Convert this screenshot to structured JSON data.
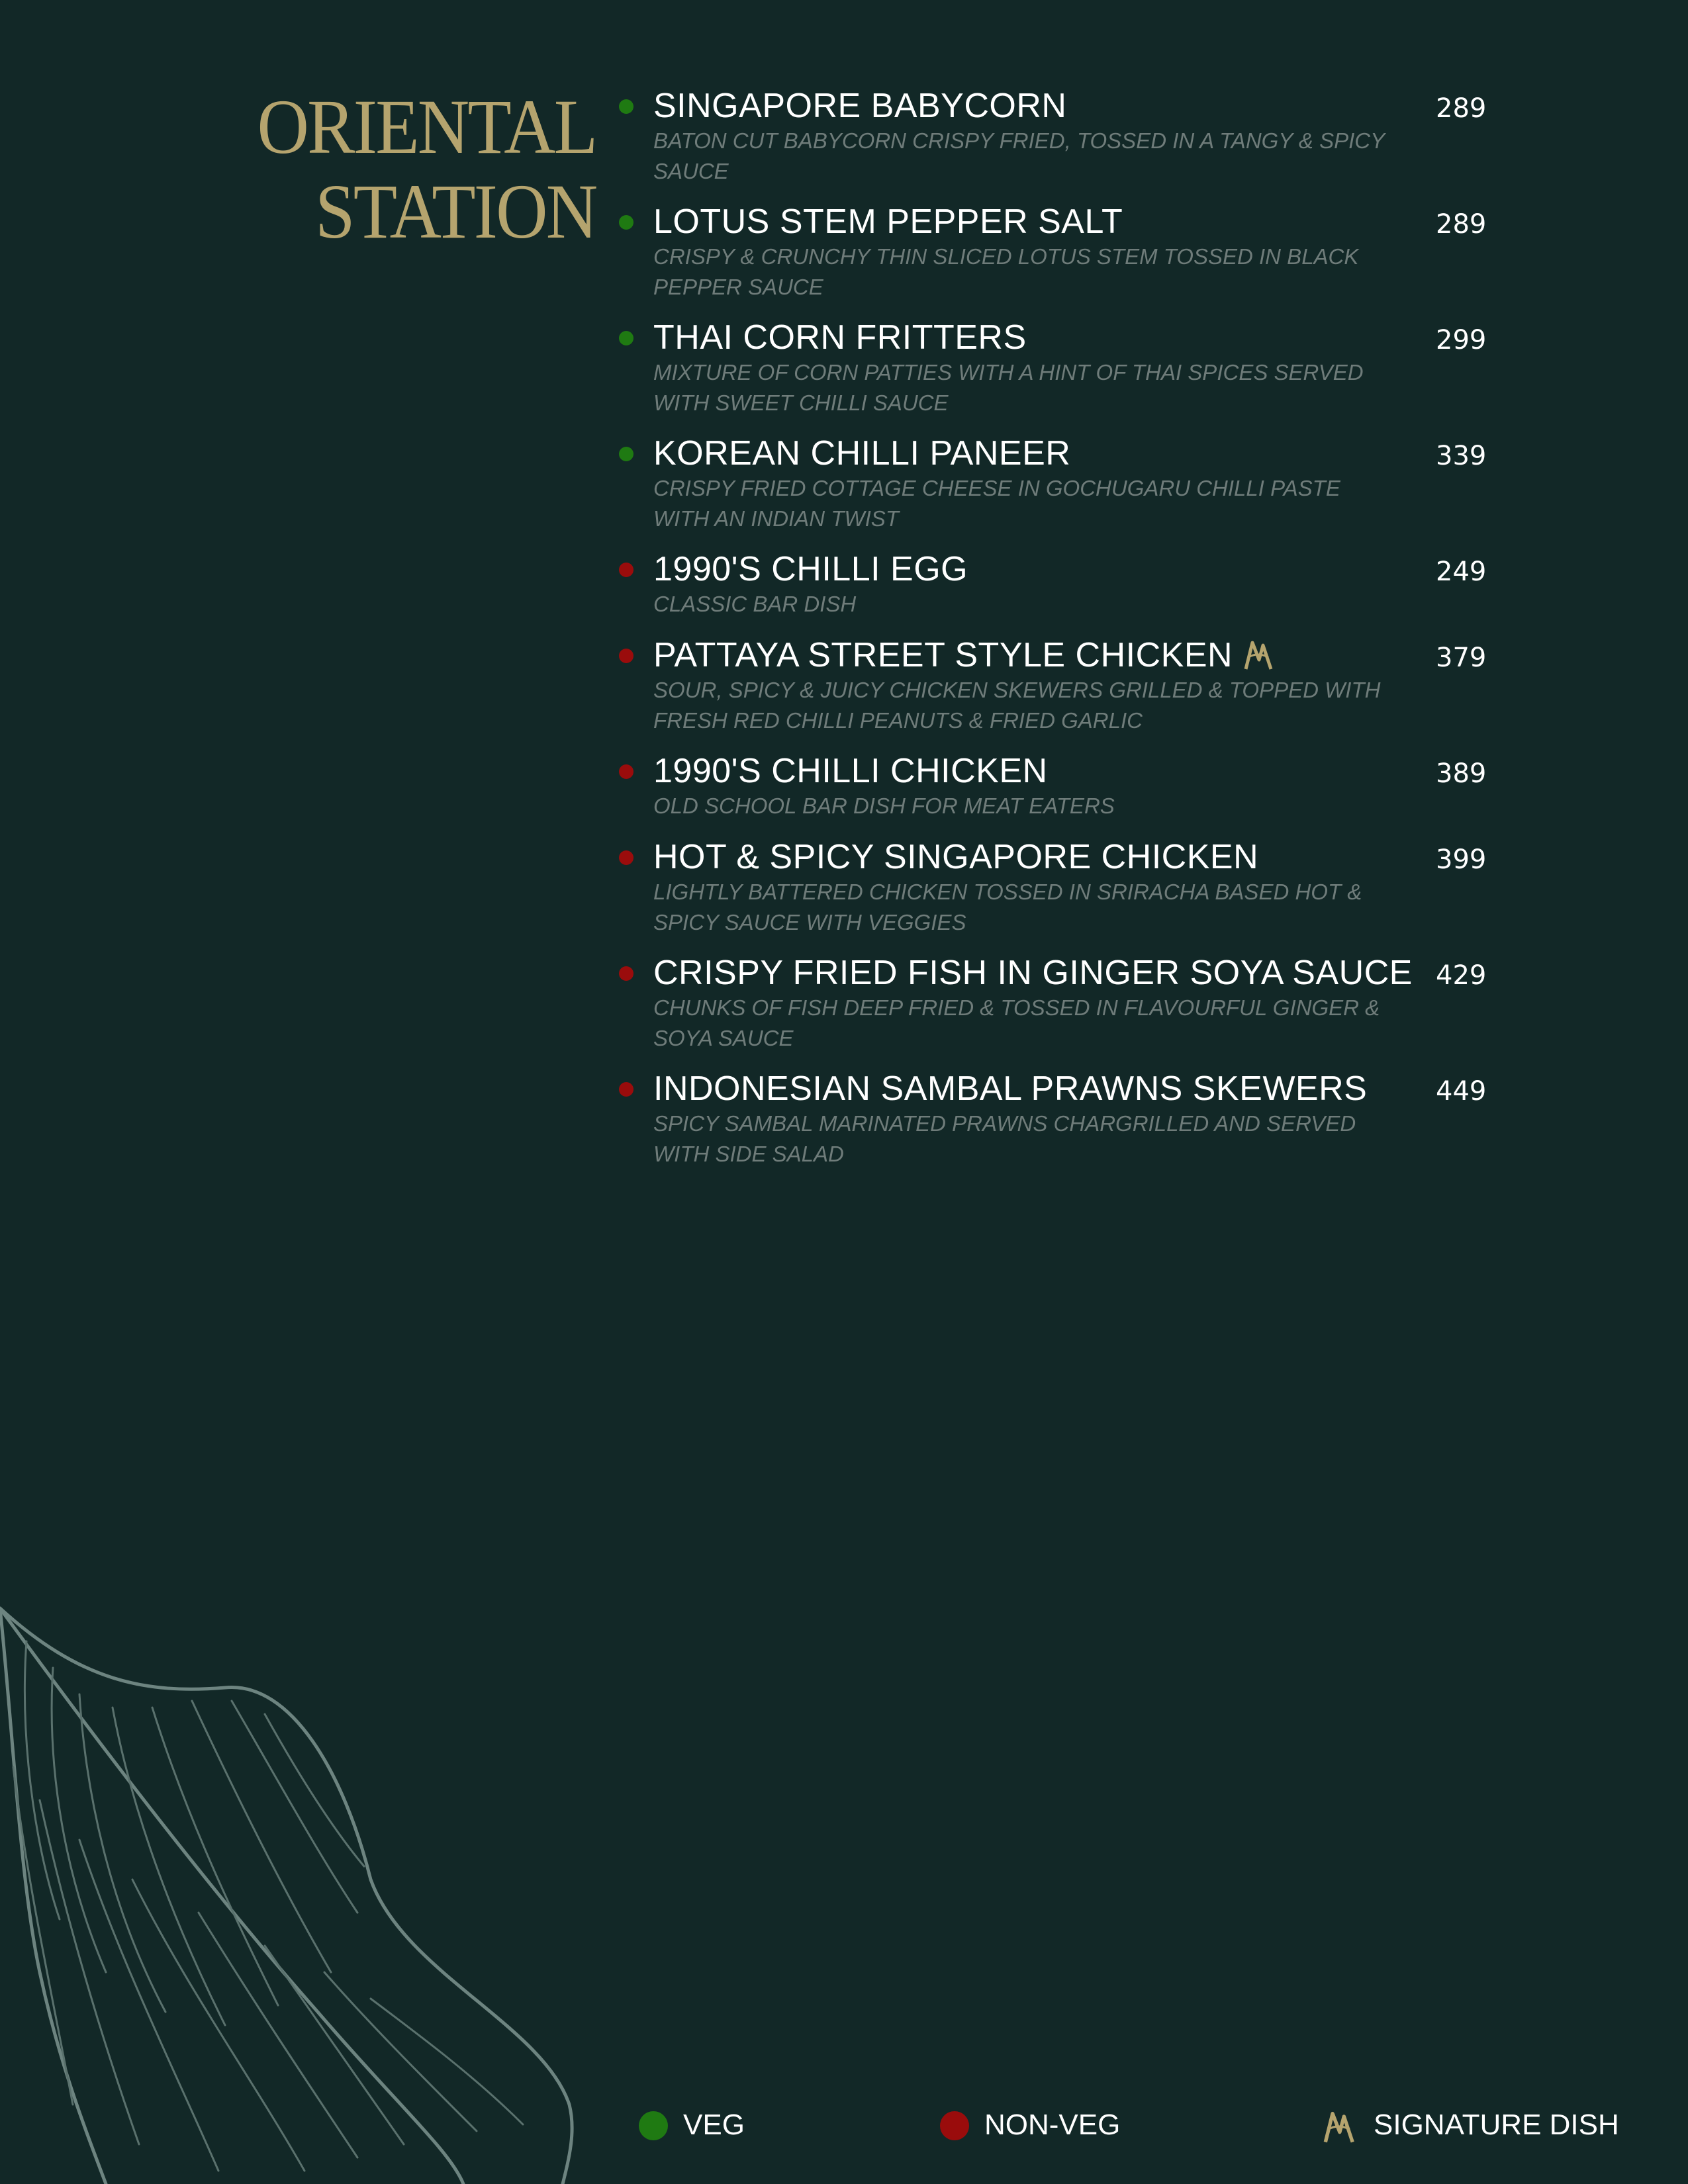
{
  "section_title": [
    "ORIENTAL",
    "STATION"
  ],
  "colors": {
    "veg": "#1f7a12",
    "non_veg": "#9a0c0c",
    "gold": "#b5a46e"
  },
  "items": [
    {
      "name": "SINGAPORE BABYCORN",
      "price": "289",
      "type": "veg",
      "signature": false,
      "desc": "BATON CUT BABYCORN CRISPY FRIED, TOSSED IN A TANGY & SPICY SAUCE"
    },
    {
      "name": "LOTUS STEM PEPPER SALT",
      "price": "289",
      "type": "veg",
      "signature": false,
      "desc": "CRISPY & CRUNCHY THIN SLICED LOTUS STEM TOSSED IN BLACK PEPPER SAUCE"
    },
    {
      "name": "THAI CORN FRITTERS",
      "price": "299",
      "type": "veg",
      "signature": false,
      "desc": "MIXTURE OF CORN PATTIES WITH A HINT OF THAI SPICES SERVED WITH SWEET CHILLI SAUCE"
    },
    {
      "name": "KOREAN CHILLI PANEER",
      "price": "339",
      "type": "veg",
      "signature": false,
      "desc": "CRISPY FRIED COTTAGE CHEESE IN GOCHUGARU CHILLI PASTE WITH AN INDIAN  TWIST"
    },
    {
      "name": "1990'S CHILLI EGG",
      "price": "249",
      "type": "non_veg",
      "signature": false,
      "desc": "CLASSIC BAR DISH"
    },
    {
      "name": "PATTAYA STREET STYLE CHICKEN",
      "price": "379",
      "type": "non_veg",
      "signature": true,
      "desc": "SOUR, SPICY & JUICY CHICKEN SKEWERS GRILLED & TOPPED WITH FRESH RED CHILLI PEANUTS & FRIED GARLIC"
    },
    {
      "name": "1990'S CHILLI CHICKEN",
      "price": "389",
      "type": "non_veg",
      "signature": false,
      "desc": "OLD SCHOOL BAR DISH FOR MEAT EATERS"
    },
    {
      "name": "HOT & SPICY SINGAPORE CHICKEN",
      "price": "399",
      "type": "non_veg",
      "signature": false,
      "desc": "LIGHTLY BATTERED CHICKEN TOSSED IN SRIRACHA BASED HOT & SPICY SAUCE WITH VEGGIES"
    },
    {
      "name": "CRISPY FRIED FISH IN GINGER SOYA SAUCE",
      "price": "429",
      "type": "non_veg",
      "signature": false,
      "desc": "CHUNKS OF FISH DEEP FRIED & TOSSED IN FLAVOURFUL GINGER & SOYA SAUCE"
    },
    {
      "name": "INDONESIAN SAMBAL PRAWNS SKEWERS",
      "price": "449",
      "type": "non_veg",
      "signature": false,
      "desc": "SPICY SAMBAL MARINATED PRAWNS CHARGRILLED AND SERVED WITH SIDE SALAD"
    }
  ],
  "legend": {
    "veg": "VEG",
    "non_veg": "NON-VEG",
    "signature": "SIGNATURE DISH"
  }
}
